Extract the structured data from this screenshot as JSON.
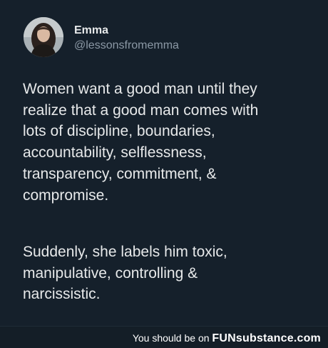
{
  "tweet": {
    "author": {
      "display_name": "Emma",
      "handle": "@lessonsfromemma"
    },
    "paragraph_1": [
      "Women want a good man until they",
      "realize that a good man comes with",
      "lots of discipline, boundaries,",
      "accountability, selflessness,",
      "transparency, commitment, &",
      "compromise."
    ],
    "paragraph_2": [
      "Suddenly, she labels him toxic,",
      "manipulative, controlling &",
      "narcissistic."
    ]
  },
  "footer": {
    "prefix": "You should be on",
    "brand": "FUNsubstance.com"
  }
}
